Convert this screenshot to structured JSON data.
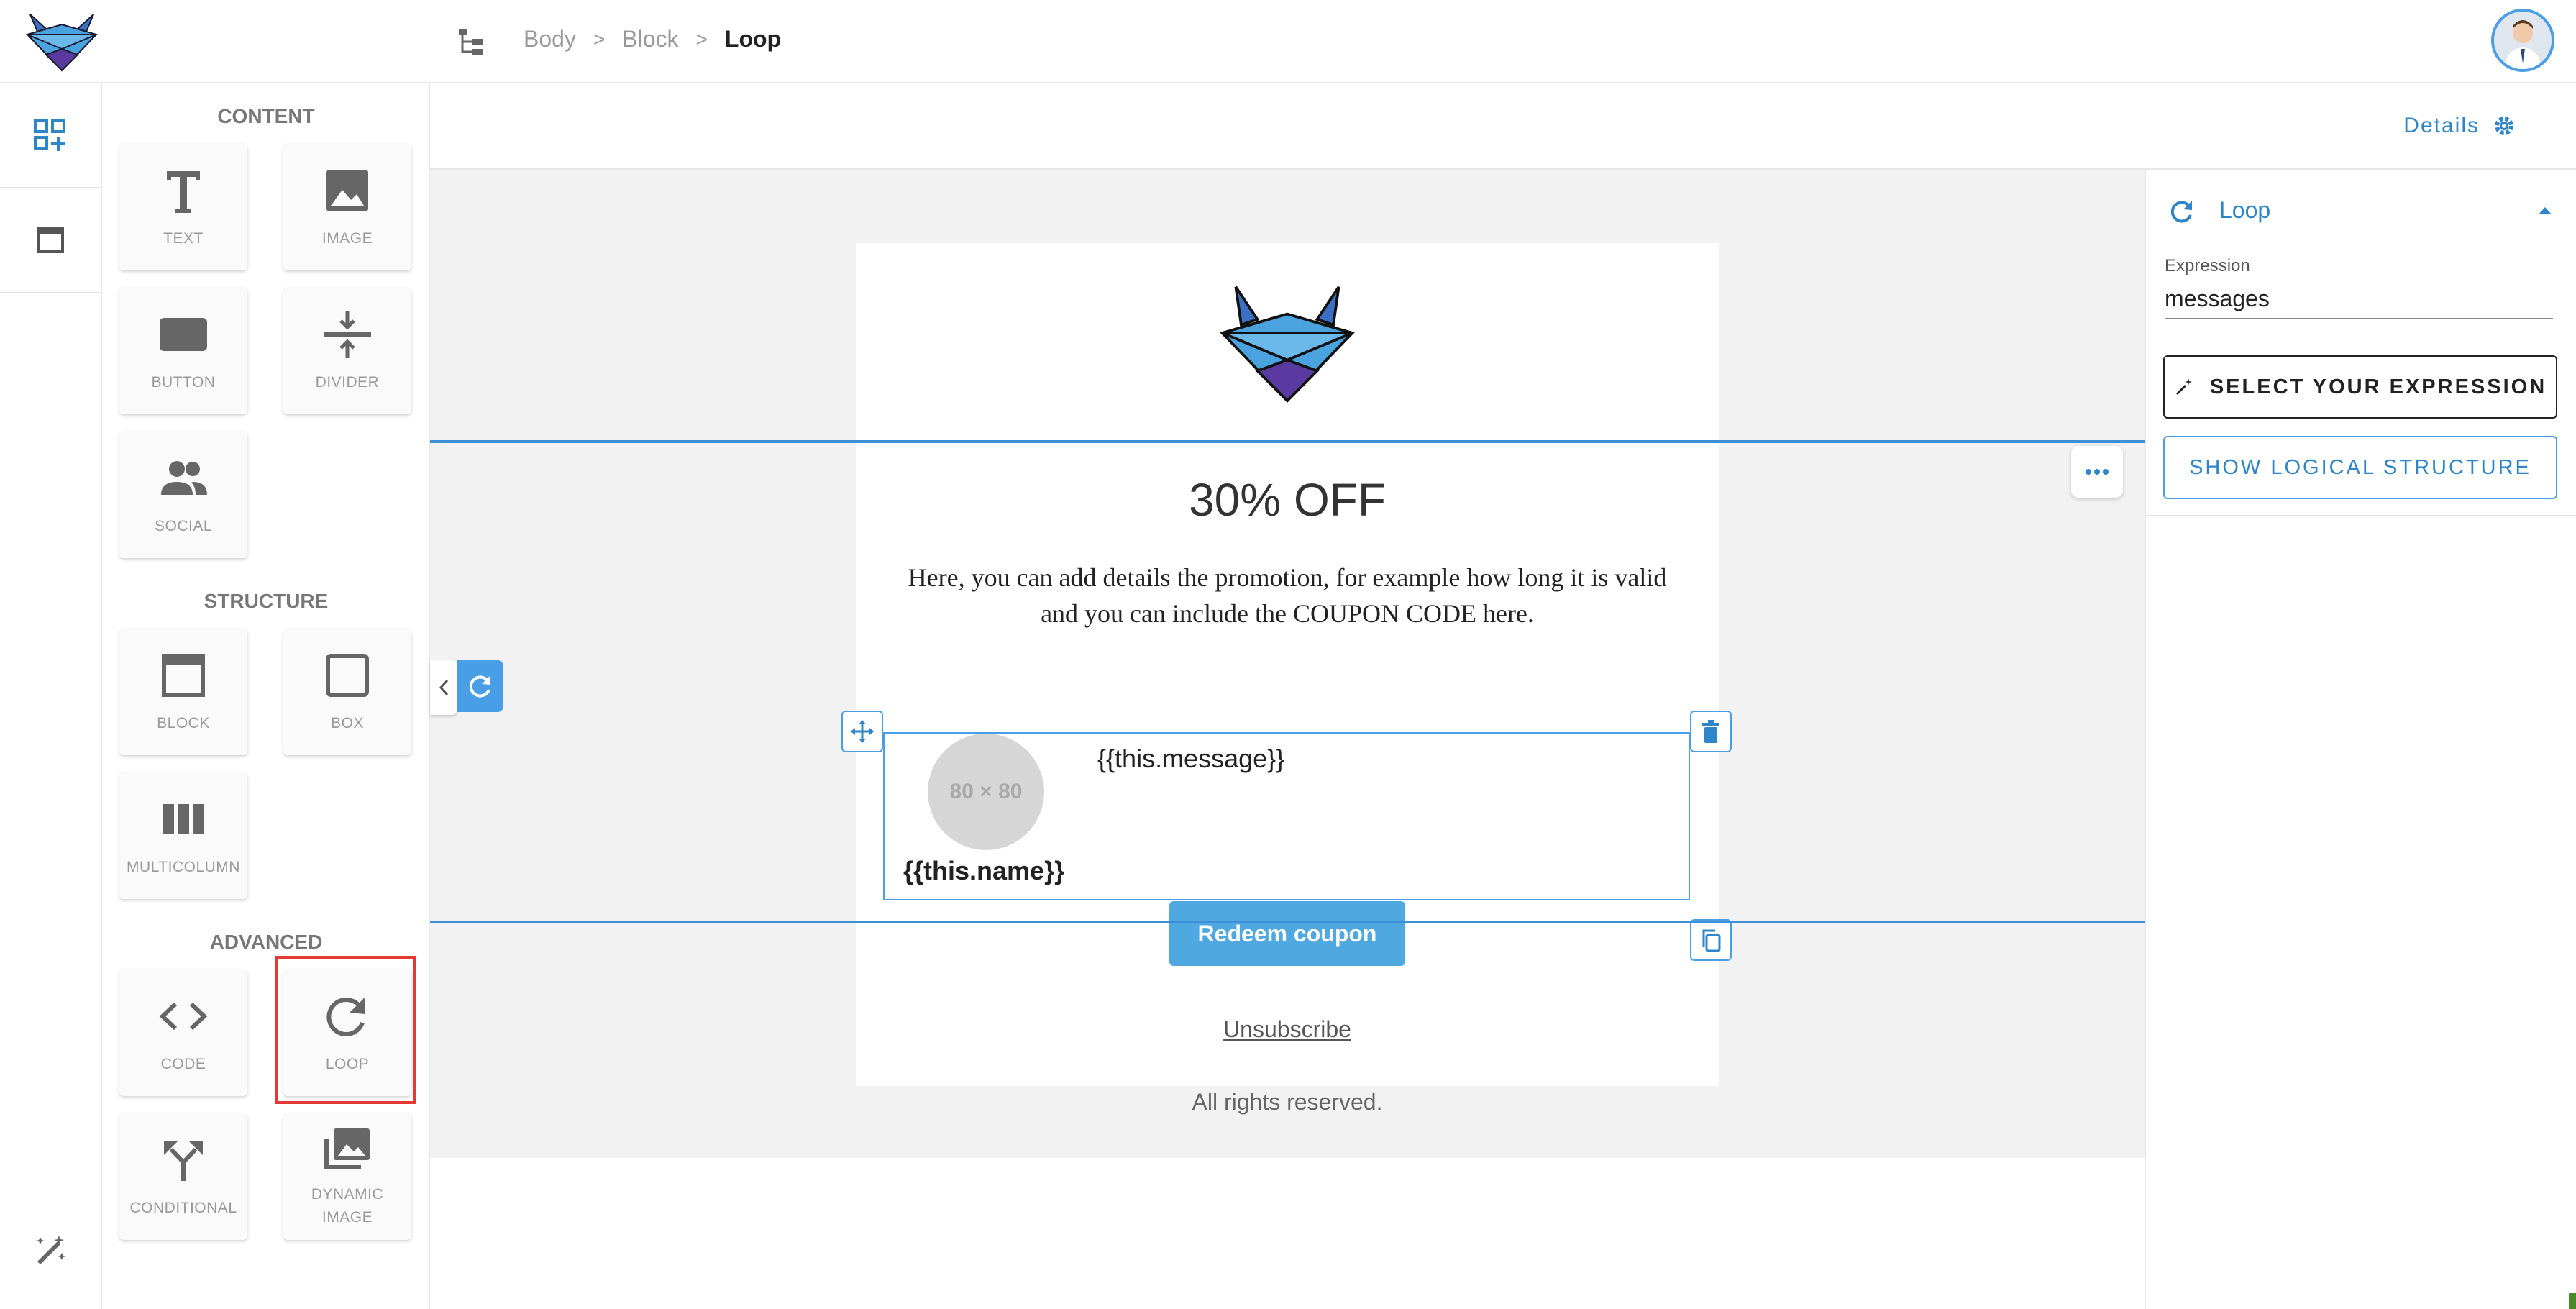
{
  "header": {
    "breadcrumb": [
      "Body",
      "Block",
      "Loop"
    ],
    "separator": ">"
  },
  "palette": {
    "sections": {
      "content": "CONTENT",
      "structure": "STRUCTURE",
      "advanced": "ADVANCED"
    },
    "tiles": {
      "text": "TEXT",
      "image": "IMAGE",
      "button": "BUTTON",
      "divider": "DIVIDER",
      "social": "SOCIAL",
      "block": "BLOCK",
      "box": "BOX",
      "multicolumn": "MULTICOLUMN",
      "code": "CODE",
      "loop": "LOOP",
      "conditional": "CONDITIONAL",
      "dynamic_image_1": "DYNAMIC",
      "dynamic_image_2": "IMAGE"
    },
    "selected_tile": "LOOP"
  },
  "canvas": {
    "details_label": "Details",
    "email": {
      "headline": "30% OFF",
      "promo_text": "Here, you can add details  the promotion, for example how long it is valid and you can include the COUPON CODE here.",
      "placeholder": "80 × 80",
      "message_var": "{{this.message}}",
      "name_var": "{{this.name}}",
      "cta": "Redeem coupon",
      "unsubscribe": "Unsubscribe",
      "rights": "All rights reserved."
    }
  },
  "right_panel": {
    "title": "Loop",
    "expression_label": "Expression",
    "expression_value": "messages",
    "select_button": "SELECT YOUR EXPRESSION",
    "structure_button": "SHOW LOGICAL STRUCTURE"
  },
  "colors": {
    "accent": "#4a9ee5",
    "link": "#2e86c8",
    "highlight": "#e53935",
    "canvas_bg": "#f2f2f2"
  }
}
